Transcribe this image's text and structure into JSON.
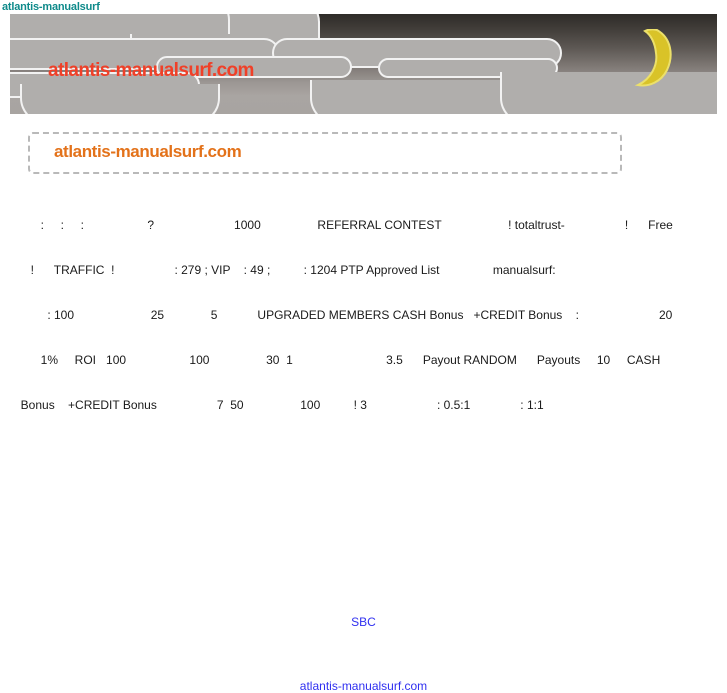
{
  "window": {
    "title": "atlantis-manualsurf"
  },
  "banner": {
    "title": "atlantis-manualsurf.com",
    "moon_icon": "crescent-moon-icon",
    "title_color": "#f04028",
    "moon_color": "#d9c328"
  },
  "header_box": {
    "title": "atlantis-manualsurf.com",
    "title_color": "#e3721a",
    "border_color": "#b9b9b9"
  },
  "content": {
    "lines": [
      "        :     :     :                   ?                        1000                 REFERRAL CONTEST                    ! totaltrust-                  !      Free",
      "     !      TRAFFIC  !                  : 279 ; VIP    : 49 ;          : 1204 PTP Approved List                manualsurf:",
      "          : 100                       25              5            UPGRADED MEMBERS CASH Bonus   +CREDIT Bonus    :                        20",
      "        1%     ROI   100                   100                 30  1                            3.5      Payout RANDOM      Payouts     10     CASH",
      "  Bonus    +CREDIT Bonus                  7  50                 100          ! 3                     : 0.5:1               : 1:1"
    ]
  },
  "links": {
    "sbc": "SBC",
    "footer": "atlantis-manualsurf.com",
    "color": "#3030f0"
  }
}
